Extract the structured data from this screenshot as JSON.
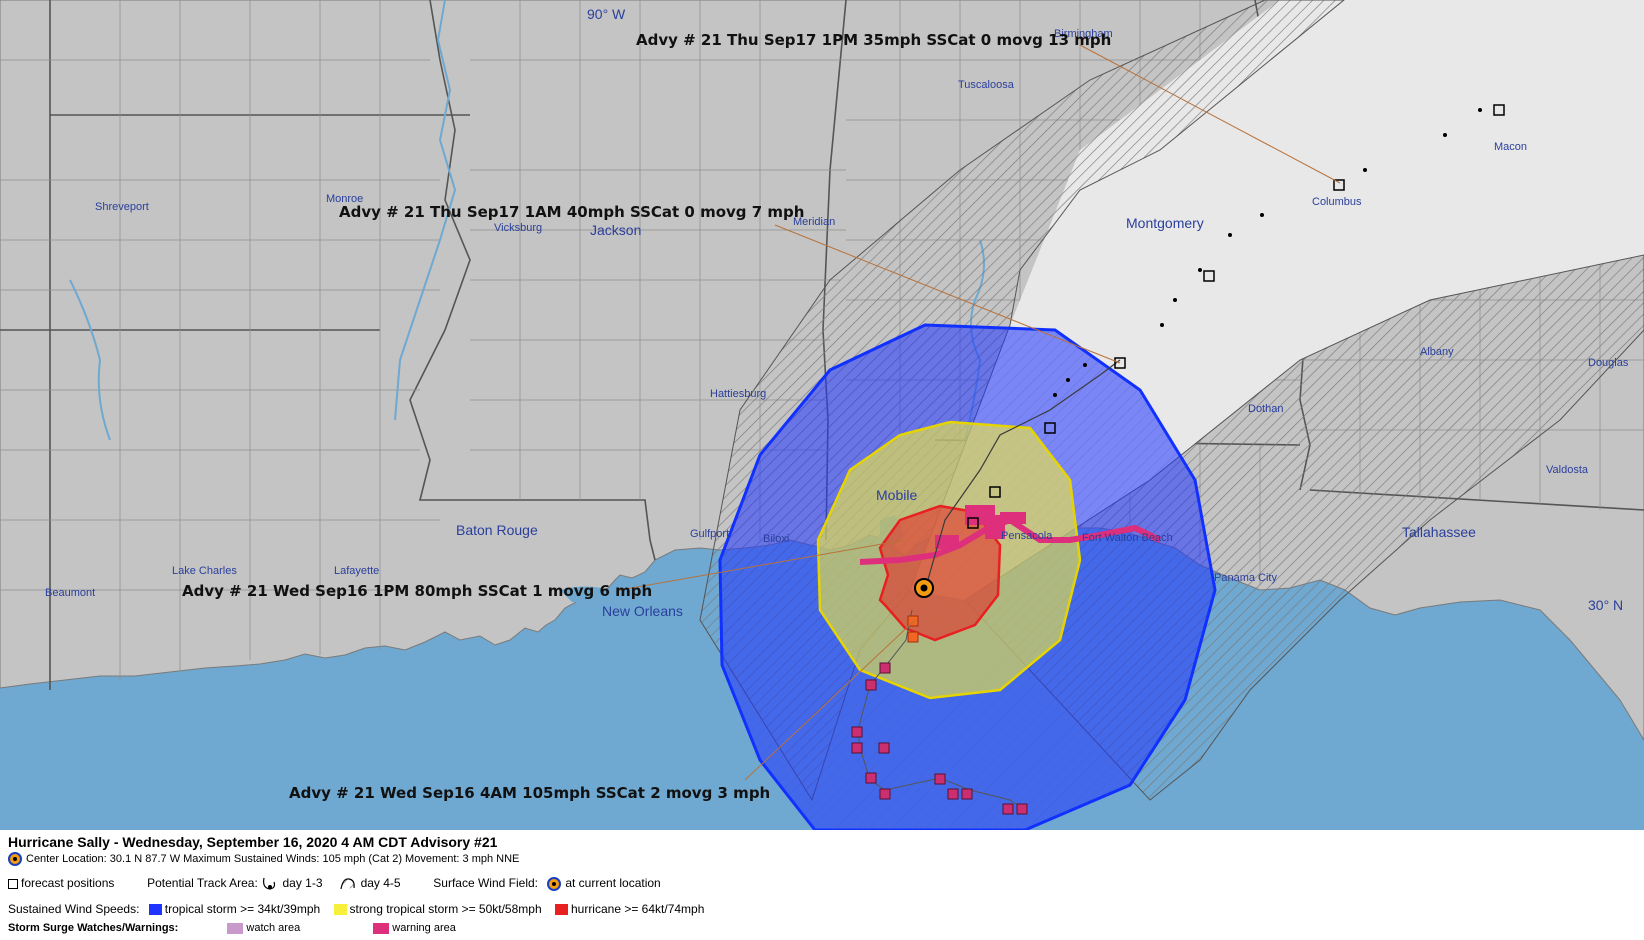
{
  "map": {
    "labels": {
      "longitude": "90° W",
      "latitude": "30° N"
    },
    "cities": [
      {
        "name": "Shreveport",
        "size": "small"
      },
      {
        "name": "Monroe",
        "size": "small"
      },
      {
        "name": "Vicksburg",
        "size": "small"
      },
      {
        "name": "Jackson",
        "size": "big"
      },
      {
        "name": "Meridian",
        "size": "small"
      },
      {
        "name": "Tuscaloosa",
        "size": "small"
      },
      {
        "name": "Birmingham",
        "size": "small"
      },
      {
        "name": "Montgomery",
        "size": "big"
      },
      {
        "name": "Columbus",
        "size": "small"
      },
      {
        "name": "Macon",
        "size": "small"
      },
      {
        "name": "Hattiesburg",
        "size": "small"
      },
      {
        "name": "Mobile",
        "size": "big"
      },
      {
        "name": "Pensacola",
        "size": "small"
      },
      {
        "name": "Fort Walton Beach",
        "size": "small"
      },
      {
        "name": "Gulfport",
        "size": "small"
      },
      {
        "name": "Biloxi",
        "size": "small"
      },
      {
        "name": "Baton Rouge",
        "size": "big"
      },
      {
        "name": "Lake Charles",
        "size": "small"
      },
      {
        "name": "Lafayette",
        "size": "small"
      },
      {
        "name": "Beaumont",
        "size": "small"
      },
      {
        "name": "New Orleans",
        "size": "big"
      },
      {
        "name": "Panama City",
        "size": "small"
      },
      {
        "name": "Dothan",
        "size": "small"
      },
      {
        "name": "Albany",
        "size": "small"
      },
      {
        "name": "Valdosta",
        "size": "small"
      },
      {
        "name": "Tallahassee",
        "size": "big"
      },
      {
        "name": "Douglas",
        "size": "small"
      }
    ],
    "advisories": [
      "Advy # 21 Thu Sep17 1PM  35mph SSCat 0 movg 13 mph",
      "Advy # 21 Thu Sep17 1AM  40mph SSCat 0 movg 7 mph",
      "Advy # 21 Wed Sep16 1PM  80mph SSCat 1 movg 6 mph",
      "Advy # 21 Wed Sep16 4AM  105mph SSCat 2 movg 3 mph"
    ],
    "colors": {
      "land": "#c4c4c4",
      "water": "#6fa8d0",
      "cone": "#e8e8e8",
      "tropical_storm": "#1f35ff",
      "strong_tropical_storm": "#f7ef3a",
      "hurricane": "#e82020",
      "surge_warning": "#dd2f7c",
      "surge_watch": "#c79acb",
      "past_track": "#cc2f6f"
    }
  },
  "legend": {
    "title": "Hurricane Sally  -  Wednesday, September 16, 2020  4 AM CDT   Advisory #21",
    "center_location": "Center Location: 30.1 N  87.7 W   Maximum Sustained Winds: 105 mph (Cat 2) Movement: 3 mph NNE",
    "forecast_positions": "forecast positions",
    "potential_track_area": "Potential Track Area:",
    "day_1_3": "day 1-3",
    "day_4_5": "day 4-5",
    "surface_wind_field": "Surface Wind Field:",
    "at_current_location": "at current location",
    "sustained_wind_speeds": "Sustained Wind Speeds:",
    "tropical_storm": "tropical storm >= 34kt/39mph",
    "strong_tropical_storm": "strong tropical storm >= 50kt/58mph",
    "hurricane": "hurricane >= 64kt/74mph",
    "storm_surge": "Storm Surge Watches/Warnings:",
    "watch_area": "watch area",
    "warning_area": "warning area"
  }
}
